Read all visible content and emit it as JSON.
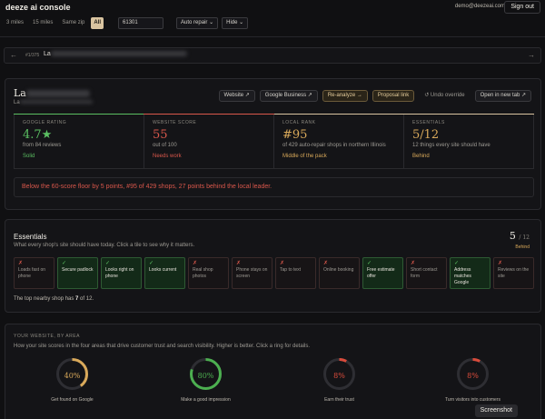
{
  "app": {
    "brand": "deeze ai console",
    "user_email": "demo@deezeai.com",
    "signout_label": "Sign out"
  },
  "filters": {
    "radius_options": [
      "3 miles",
      "15 miles",
      "Same zip",
      "All"
    ],
    "active_radius": "All",
    "zip_value": "61301",
    "category_value": "Auto repair",
    "hide_label": "Hide"
  },
  "nav": {
    "prev_icon": "arrow-left-icon",
    "next_icon": "arrow-right-icon",
    "count": "#1/375",
    "name_prefix": "La"
  },
  "business": {
    "name_prefix": "La",
    "sub_prefix": "La",
    "actions": [
      {
        "label": "Website ↗",
        "style": "default"
      },
      {
        "label": "Google Business ↗",
        "style": "default"
      },
      {
        "label": "Re-analyze →",
        "style": "gold"
      },
      {
        "label": "Proposal link",
        "style": "gold"
      },
      {
        "label": "↺ Undo override",
        "style": "plain"
      },
      {
        "label": "Open in new tab ↗",
        "style": "default"
      }
    ]
  },
  "metrics": [
    {
      "key": "GOOGLE RATING",
      "value": "4.7★",
      "sub": "from 84 reviews",
      "tag": "Solid",
      "color": "#5bbf62",
      "bar": "#5bbf62"
    },
    {
      "key": "WEBSITE SCORE",
      "value": "55",
      "sub": "out of 100",
      "tag": "Needs work",
      "color": "#d9574b",
      "bar": "#d9574b"
    },
    {
      "key": "LOCAL RANK",
      "value": "#95",
      "sub": "of 429 auto-repair shops in northern Illinois",
      "tag": "Middle of the pack",
      "color": "#d9a95a",
      "bar": "#d9c4a0"
    },
    {
      "key": "ESSENTIALS",
      "value": "5/12",
      "sub": "12 things every site should have",
      "tag": "Behind",
      "color": "#d9a95a",
      "bar": "#d9c4a0"
    }
  ],
  "alert": "Below the 60-score floor by 5 points, #95 of 429 shops, 27 points behind the local leader.",
  "essentials": {
    "title": "Essentials",
    "subtitle": "What every shop's site should have today. Click a tile to see why it matters.",
    "score": "5",
    "score_total": "/ 12",
    "score_label": "Behind",
    "tiles": [
      {
        "label": "Loads fast on phone",
        "pass": false
      },
      {
        "label": "Secure padlock",
        "pass": true
      },
      {
        "label": "Looks right on phone",
        "pass": true
      },
      {
        "label": "Looks current",
        "pass": true
      },
      {
        "label": "Real shop photos",
        "pass": false
      },
      {
        "label": "Phone stays on screen",
        "pass": false
      },
      {
        "label": "Tap to text",
        "pass": false
      },
      {
        "label": "Online booking",
        "pass": false
      },
      {
        "label": "Free estimate offer",
        "pass": true
      },
      {
        "label": "Short contact form",
        "pass": false
      },
      {
        "label": "Address matches Google",
        "pass": true
      },
      {
        "label": "Reviews on the site",
        "pass": false
      }
    ],
    "note_prefix": "The top nearby shop has ",
    "note_count": "7",
    "note_suffix": " of 12."
  },
  "areas": {
    "title": "YOUR WEBSITE, BY AREA",
    "subtitle": "How your site scores in the four areas that drive customer trust and search visibility. Higher is better. Click a ring for details.",
    "items": [
      {
        "label": "Get found on Google",
        "value": 40,
        "display": "40%",
        "color": "#d9a95a"
      },
      {
        "label": "Make a good impression",
        "value": 80,
        "display": "80%",
        "color": "#4caf50"
      },
      {
        "label": "Earn their trust",
        "value": 8,
        "display": "8%",
        "color": "#d94b3b"
      },
      {
        "label": "Turn visitors into customers",
        "value": 8,
        "display": "8%",
        "color": "#d94b3b"
      }
    ]
  },
  "overlay_label": "Screenshot"
}
